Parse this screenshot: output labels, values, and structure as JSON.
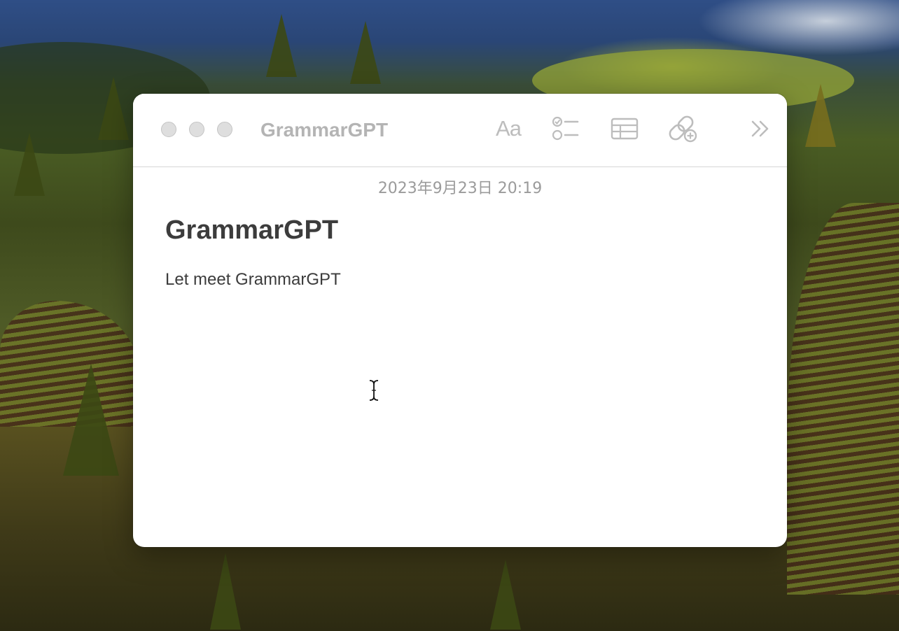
{
  "window": {
    "title": "GrammarGPT"
  },
  "toolbar": {
    "format_label": "Aa",
    "icons": [
      "format-icon",
      "checklist-icon",
      "table-icon",
      "link-icon",
      "more-icon"
    ]
  },
  "note": {
    "date": "2023年9月23日 20:19",
    "title": "GrammarGPT",
    "body": "Let meet GrammarGPT"
  },
  "colors": {
    "window_background": "#ffffff",
    "title_text": "#b4b4b4",
    "toolbar_icon": "#bdbdbd",
    "date_text": "#9b9b9b",
    "note_text": "#3c3c3c",
    "traffic_light_inactive": "#dedede"
  }
}
